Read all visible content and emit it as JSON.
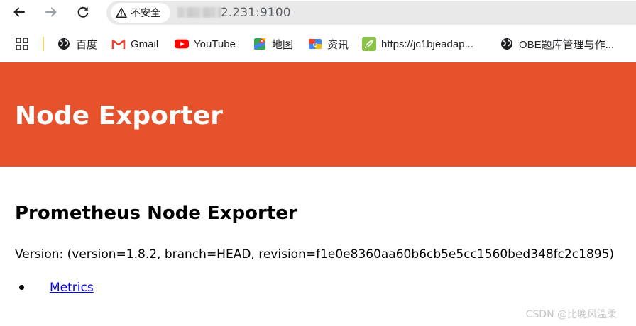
{
  "toolbar": {
    "back_icon": "arrow-left-icon",
    "forward_icon": "arrow-right-icon",
    "reload_icon": "reload-icon",
    "security_label": "不安全",
    "url_visible": "2.231:9100"
  },
  "bookmarks": [
    {
      "label": "百度",
      "icon": "globe-icon"
    },
    {
      "label": "Gmail",
      "icon": "gmail-icon"
    },
    {
      "label": "YouTube",
      "icon": "youtube-icon"
    },
    {
      "label": "地图",
      "icon": "maps-icon"
    },
    {
      "label": "资讯",
      "icon": "news-icon"
    },
    {
      "label": "https://jc1bjeadap...",
      "icon": "leaf-icon"
    },
    {
      "label": "OBE题库管理与作...",
      "icon": "globe-icon"
    }
  ],
  "banner": {
    "title": "Node Exporter",
    "color": "#e6522c"
  },
  "main": {
    "heading": "Prometheus Node Exporter",
    "version_text": "Version: (version=1.8.2, branch=HEAD, revision=f1e0e8360aa60b6cb5e5cc1560bed348fc2c1895)",
    "links": [
      {
        "label": "Metrics"
      }
    ]
  },
  "watermark": "CSDN @比晚风温柔"
}
